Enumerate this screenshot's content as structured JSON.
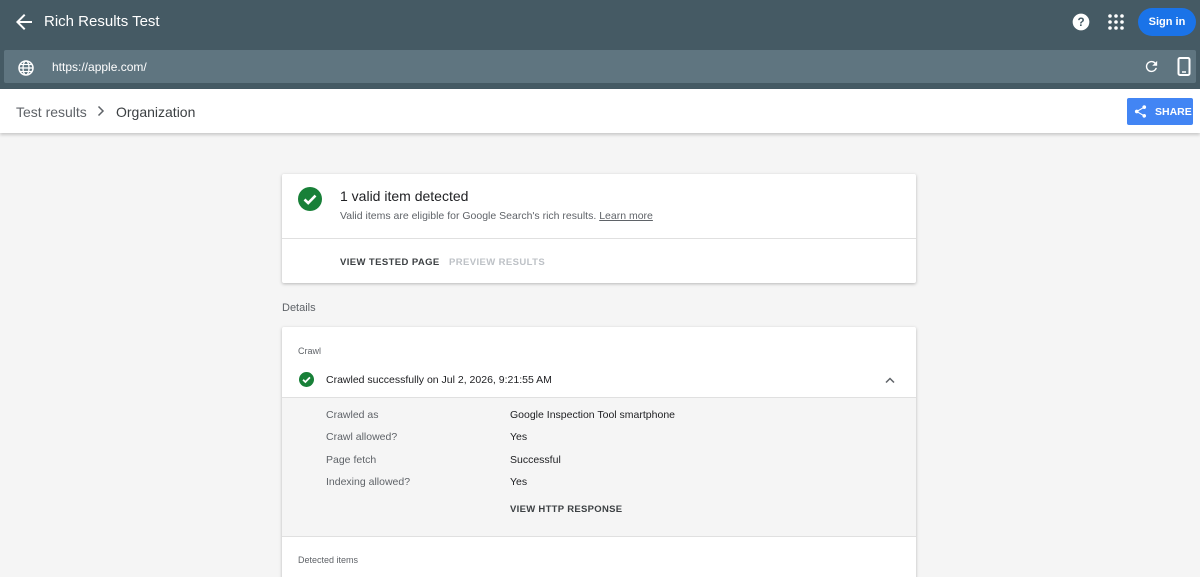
{
  "app": {
    "title": "Rich Results Test",
    "signin_label": "Sign in"
  },
  "urlbar": {
    "url": "https://apple.com/"
  },
  "breadcrumb": {
    "root": "Test results",
    "current": "Organization",
    "share_label": "SHARE"
  },
  "summary": {
    "title": "1 valid item detected",
    "subtitle": "Valid items are eligible for Google Search's rich results.",
    "learn_more": "Learn more",
    "tab_view": "VIEW TESTED PAGE",
    "tab_preview": "PREVIEW RESULTS"
  },
  "details": {
    "label": "Details",
    "crawl_heading": "Crawl",
    "crawl_status": "Crawled successfully on Jul 2, 2026, 9:21:55 AM",
    "rows": [
      {
        "key": "Crawled as",
        "value": "Google Inspection Tool smartphone"
      },
      {
        "key": "Crawl allowed?",
        "value": "Yes"
      },
      {
        "key": "Page fetch",
        "value": "Successful"
      },
      {
        "key": "Indexing allowed?",
        "value": "Yes"
      }
    ],
    "http_response": "VIEW HTTP RESPONSE",
    "detected_heading": "Detected items"
  },
  "colors": {
    "header": "#455a64",
    "accent": "#1a73e8",
    "share": "#4285f4",
    "success": "#188038"
  },
  "icons": [
    "back-arrow-icon",
    "help-icon",
    "apps-grid-icon",
    "globe-icon",
    "refresh-icon",
    "smartphone-icon",
    "chevron-right-icon",
    "share-icon",
    "check-circle-icon",
    "chevron-up-icon"
  ]
}
